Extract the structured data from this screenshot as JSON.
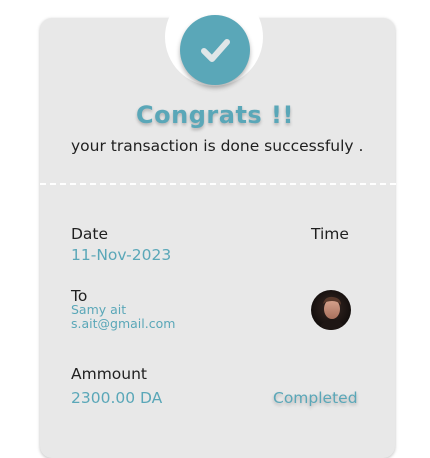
{
  "header": {
    "title": "Congrats !!",
    "message": "your transaction is done successfuly ."
  },
  "details": {
    "date_label": "Date",
    "date_value": "11-Nov-2023",
    "time_label": "Time",
    "to_label": "To",
    "recipient_name": "Samy ait",
    "recipient_email": "s.ait@gmail.com",
    "amount_label": "Ammount",
    "amount_value": "2300.00 DA",
    "status": "Completed"
  },
  "icons": {
    "success": "check-icon",
    "avatar": "user-avatar"
  },
  "colors": {
    "accent": "#5aa7b8",
    "card": "#e8e8e8",
    "text": "#1f1f1f"
  }
}
